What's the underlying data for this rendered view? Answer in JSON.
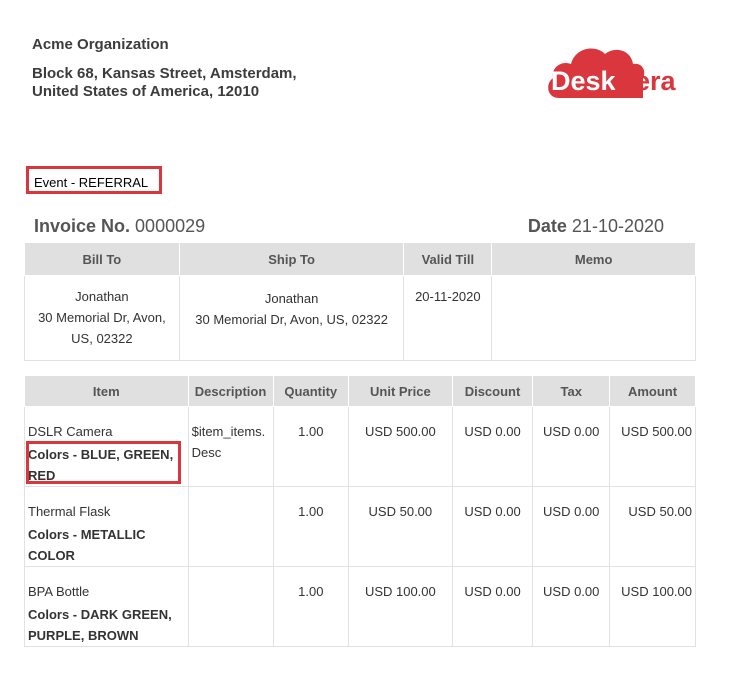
{
  "org": {
    "name": "Acme Organization",
    "address_line1": "Block 68, Kansas Street, Amsterdam,",
    "address_line2": "United States of America, 12010"
  },
  "logo": {
    "text_main": "Desk",
    "text_accent": "era",
    "brand_color": "#d9363e"
  },
  "event": {
    "label": "Event - REFERRAL"
  },
  "invoice": {
    "number_label": "Invoice No.",
    "number_value": "0000029",
    "date_label": "Date",
    "date_value": "21-10-2020"
  },
  "parties": {
    "headers": [
      "Bill To",
      "Ship To",
      "Valid Till",
      "Memo"
    ],
    "bill_to": {
      "line1": "Jonathan",
      "line2": "30 Memorial Dr, Avon,",
      "line3": "US, 02322"
    },
    "ship_to": {
      "line1": "Jonathan",
      "line2": "30 Memorial Dr, Avon, US, 02322"
    },
    "valid_till": "20-11-2020",
    "memo": ""
  },
  "items": {
    "headers": [
      "Item",
      "Description",
      "Quantity",
      "Unit Price",
      "Discount",
      "Tax",
      "Amount"
    ],
    "rows": [
      {
        "name": "DSLR Camera",
        "colors": "Colors - BLUE, GREEN, RED",
        "description": "$item_items. Desc",
        "quantity": "1.00",
        "unit_price": "USD 500.00",
        "discount": "USD 0.00",
        "tax": "USD 0.00",
        "amount": "USD 500.00"
      },
      {
        "name": "Thermal Flask",
        "colors": "Colors - METALLIC COLOR",
        "description": "",
        "quantity": "1.00",
        "unit_price": "USD 50.00",
        "discount": "USD 0.00",
        "tax": "USD 0.00",
        "amount": "USD 50.00"
      },
      {
        "name": "BPA Bottle",
        "colors": "Colors - DARK GREEN, PURPLE, BROWN",
        "description": "",
        "quantity": "1.00",
        "unit_price": "USD 100.00",
        "discount": "USD 0.00",
        "tax": "USD 0.00",
        "amount": "USD 100.00"
      }
    ]
  },
  "colors": {
    "highlight": "#d9363e",
    "header_bg": "#e0e0e0",
    "text": "#333333"
  }
}
